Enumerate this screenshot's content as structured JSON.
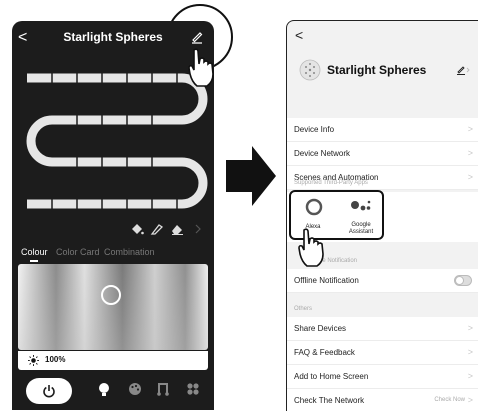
{
  "left": {
    "title": "Starlight Spheres",
    "tabs": [
      "Colour",
      "Color Card",
      "Combination"
    ],
    "brightness": "100%",
    "icons": {
      "back": "<",
      "edit": "edit-icon",
      "power": "power-icon",
      "bulb": "bulb-icon",
      "palette": "palette-icon",
      "music": "music-icon",
      "grid": "grid-icon"
    }
  },
  "right": {
    "back": "<",
    "title": "Starlight Spheres",
    "rows": {
      "device_info": "Device Info",
      "device_network": "Device Network",
      "scenes": "Scenes and Automation",
      "offline": "Offline Notification",
      "share": "Share Devices",
      "faq": "FAQ & Feedback",
      "add_home": "Add to Home Screen",
      "check_network": "Check The Network"
    },
    "sections": {
      "third_party": "Supported Third-Party Apps",
      "notification": "Offline Notification",
      "notification_visible": "ne Notification",
      "others": "Others"
    },
    "apps": {
      "alexa": "Alexa",
      "google_line1": "Google",
      "google_line2": "Assistant"
    },
    "check_now": "Check Now",
    "chevron": ">",
    "offline_toggle_on": false
  },
  "colors": {
    "dark_bg": "#1c1c1c",
    "light_bg": "#f2f2f2"
  }
}
